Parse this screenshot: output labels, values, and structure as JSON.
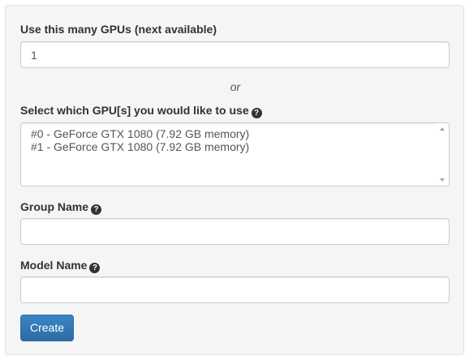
{
  "form": {
    "gpu_count": {
      "label": "Use this many GPUs (next available)",
      "value": "1"
    },
    "or_text": "or",
    "gpu_select": {
      "label": "Select which GPU[s] you would like to use",
      "options": [
        "#0 - GeForce GTX 1080 (7.92 GB memory)",
        "#1 - GeForce GTX 1080 (7.92 GB memory)"
      ]
    },
    "group_name": {
      "label": "Group Name",
      "value": ""
    },
    "model_name": {
      "label": "Model Name",
      "value": ""
    },
    "create_label": "Create",
    "help_icon_glyph": "?"
  },
  "colors": {
    "panel_bg": "#f5f5f5",
    "button_primary": "#337ab7"
  }
}
